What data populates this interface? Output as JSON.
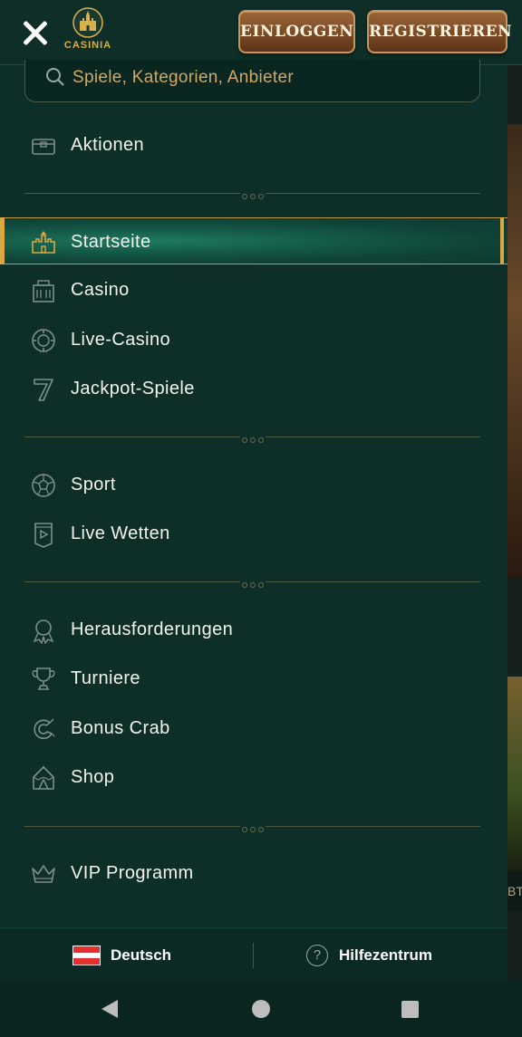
{
  "header": {
    "logo_text": "CASINIA",
    "login_label": "EINLOGGEN",
    "register_label": "REGISTRIEREN"
  },
  "search": {
    "placeholder": "Spiele, Kategorien, Anbieter"
  },
  "menu": {
    "promo": [
      {
        "label": "Aktionen",
        "icon": "treasure-chest-icon"
      }
    ],
    "casino": [
      {
        "label": "Startseite",
        "icon": "castle-icon",
        "active": true
      },
      {
        "label": "Casino",
        "icon": "casino-building-icon"
      },
      {
        "label": "Live-Casino",
        "icon": "poker-chip-icon"
      },
      {
        "label": "Jackpot-Spiele",
        "icon": "seven-icon"
      }
    ],
    "sport": [
      {
        "label": "Sport",
        "icon": "soccer-ball-icon"
      },
      {
        "label": "Live Wetten",
        "icon": "live-bet-banner-icon"
      }
    ],
    "extras": [
      {
        "label": "Herausforderungen",
        "icon": "medal-icon"
      },
      {
        "label": "Turniere",
        "icon": "trophy-icon"
      },
      {
        "label": "Bonus Crab",
        "icon": "crab-claw-icon"
      },
      {
        "label": "Shop",
        "icon": "tent-icon"
      }
    ],
    "vip": [
      {
        "label": "VIP Programm",
        "icon": "crown-icon"
      }
    ]
  },
  "footer": {
    "language_label": "Deutsch",
    "language_flag": "austria-flag-icon",
    "help_label": "Hilfezentrum"
  },
  "background_peek_text": "BT",
  "colors": {
    "panel": "#0d2f28",
    "accent_gold": "#d9a840",
    "placeholder_gold": "#d3a862",
    "button_brown": "#7a4a26"
  }
}
